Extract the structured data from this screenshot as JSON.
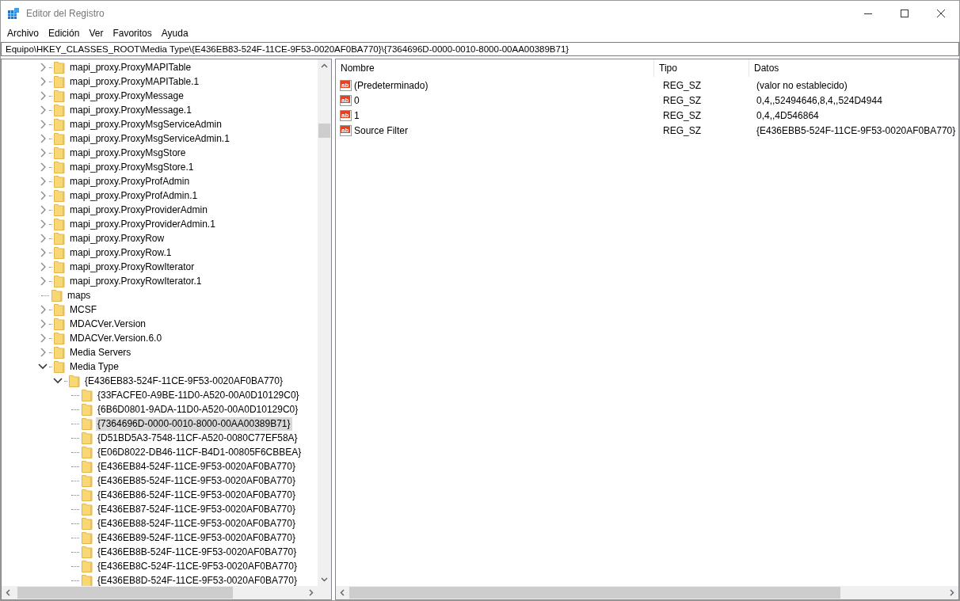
{
  "window": {
    "title": "Editor del Registro"
  },
  "menu": [
    "Archivo",
    "Edición",
    "Ver",
    "Favoritos",
    "Ayuda"
  ],
  "address": "Equipo\\HKEY_CLASSES_ROOT\\Media Type\\{E436EB83-524F-11CE-9F53-0020AF0BA770}\\{7364696D-0000-0010-8000-00AA00389B71}",
  "tree": [
    {
      "label": "mapi_proxy.ProxyMAPITable",
      "kind": "branch",
      "expanded": false,
      "selected": false
    },
    {
      "label": "mapi_proxy.ProxyMAPITable.1",
      "kind": "branch",
      "expanded": false,
      "selected": false
    },
    {
      "label": "mapi_proxy.ProxyMessage",
      "kind": "branch",
      "expanded": false,
      "selected": false
    },
    {
      "label": "mapi_proxy.ProxyMessage.1",
      "kind": "branch",
      "expanded": false,
      "selected": false
    },
    {
      "label": "mapi_proxy.ProxyMsgServiceAdmin",
      "kind": "branch",
      "expanded": false,
      "selected": false
    },
    {
      "label": "mapi_proxy.ProxyMsgServiceAdmin.1",
      "kind": "branch",
      "expanded": false,
      "selected": false
    },
    {
      "label": "mapi_proxy.ProxyMsgStore",
      "kind": "branch",
      "expanded": false,
      "selected": false
    },
    {
      "label": "mapi_proxy.ProxyMsgStore.1",
      "kind": "branch",
      "expanded": false,
      "selected": false
    },
    {
      "label": "mapi_proxy.ProxyProfAdmin",
      "kind": "branch",
      "expanded": false,
      "selected": false
    },
    {
      "label": "mapi_proxy.ProxyProfAdmin.1",
      "kind": "branch",
      "expanded": false,
      "selected": false
    },
    {
      "label": "mapi_proxy.ProxyProviderAdmin",
      "kind": "branch",
      "expanded": false,
      "selected": false
    },
    {
      "label": "mapi_proxy.ProxyProviderAdmin.1",
      "kind": "branch",
      "expanded": false,
      "selected": false
    },
    {
      "label": "mapi_proxy.ProxyRow",
      "kind": "branch",
      "expanded": false,
      "selected": false
    },
    {
      "label": "mapi_proxy.ProxyRow.1",
      "kind": "branch",
      "expanded": false,
      "selected": false
    },
    {
      "label": "mapi_proxy.ProxyRowIterator",
      "kind": "branch",
      "expanded": false,
      "selected": false
    },
    {
      "label": "mapi_proxy.ProxyRowIterator.1",
      "kind": "branch",
      "expanded": false,
      "selected": false
    },
    {
      "label": "maps",
      "kind": "leaf",
      "selected": false
    },
    {
      "label": "MCSF",
      "kind": "branch",
      "expanded": false,
      "selected": false
    },
    {
      "label": "MDACVer.Version",
      "kind": "branch",
      "expanded": false,
      "selected": false
    },
    {
      "label": "MDACVer.Version.6.0",
      "kind": "branch",
      "expanded": false,
      "selected": false
    },
    {
      "label": "Media Servers",
      "kind": "branch",
      "expanded": false,
      "selected": false
    },
    {
      "label": "Media Type",
      "kind": "branch",
      "expanded": true,
      "selected": false,
      "children": [
        {
          "label": "{E436EB83-524F-11CE-9F53-0020AF0BA770}",
          "kind": "branch",
          "expanded": true,
          "selected": false,
          "children": [
            {
              "label": "{33FACFE0-A9BE-11D0-A520-00A0D10129C0}",
              "kind": "leaf",
              "selected": false
            },
            {
              "label": "{6B6D0801-9ADA-11D0-A520-00A0D10129C0}",
              "kind": "leaf",
              "selected": false
            },
            {
              "label": "{7364696D-0000-0010-8000-00AA00389B71}",
              "kind": "leaf",
              "selected": true
            },
            {
              "label": "{D51BD5A3-7548-11CF-A520-0080C77EF58A}",
              "kind": "leaf",
              "selected": false
            },
            {
              "label": "{E06D8022-DB46-11CF-B4D1-00805F6CBBEA}",
              "kind": "leaf",
              "selected": false
            },
            {
              "label": "{E436EB84-524F-11CE-9F53-0020AF0BA770}",
              "kind": "leaf",
              "selected": false
            },
            {
              "label": "{E436EB85-524F-11CE-9F53-0020AF0BA770}",
              "kind": "leaf",
              "selected": false
            },
            {
              "label": "{E436EB86-524F-11CE-9F53-0020AF0BA770}",
              "kind": "leaf",
              "selected": false
            },
            {
              "label": "{E436EB87-524F-11CE-9F53-0020AF0BA770}",
              "kind": "leaf",
              "selected": false
            },
            {
              "label": "{E436EB88-524F-11CE-9F53-0020AF0BA770}",
              "kind": "leaf",
              "selected": false
            },
            {
              "label": "{E436EB89-524F-11CE-9F53-0020AF0BA770}",
              "kind": "leaf",
              "selected": false
            },
            {
              "label": "{E436EB8B-524F-11CE-9F53-0020AF0BA770}",
              "kind": "leaf",
              "selected": false
            },
            {
              "label": "{E436EB8C-524F-11CE-9F53-0020AF0BA770}",
              "kind": "leaf",
              "selected": false
            },
            {
              "label": "{E436EB8D-524F-11CE-9F53-0020AF0BA770}",
              "kind": "leaf",
              "selected": false
            }
          ]
        }
      ]
    }
  ],
  "values": {
    "columns": [
      "Nombre",
      "Tipo",
      "Datos"
    ],
    "rows": [
      {
        "icon": "ab",
        "name": "(Predeterminado)",
        "type": "REG_SZ",
        "data": "(valor no establecido)"
      },
      {
        "icon": "ab",
        "name": "0",
        "type": "REG_SZ",
        "data": "0,4,,52494646,8,4,,524D4944"
      },
      {
        "icon": "ab",
        "name": "1",
        "type": "REG_SZ",
        "data": "0,4,,4D546864"
      },
      {
        "icon": "ab",
        "name": "Source Filter",
        "type": "REG_SZ",
        "data": "{E436EBB5-524F-11CE-9F53-0020AF0BA770}"
      }
    ]
  }
}
